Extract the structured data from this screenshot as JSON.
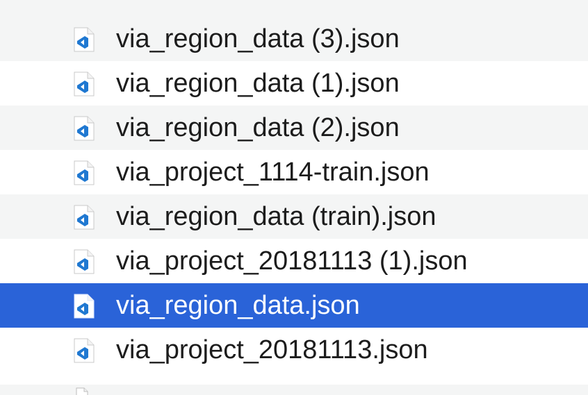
{
  "colors": {
    "stripe": "#f4f5f5",
    "selection": "#2a63d8",
    "text": "#1c1c1c",
    "selected_text": "#ffffff",
    "vscode_icon_blue": "#1f78d1"
  },
  "file_list": {
    "icon_name": "vscode-json-file-icon",
    "items": [
      {
        "name": "via_region_data (3).json",
        "selected": false
      },
      {
        "name": "via_region_data (1).json",
        "selected": false
      },
      {
        "name": "via_region_data (2).json",
        "selected": false
      },
      {
        "name": "via_project_1114-train.json",
        "selected": false
      },
      {
        "name": "via_region_data (train).json",
        "selected": false
      },
      {
        "name": "via_project_20181113 (1).json",
        "selected": false
      },
      {
        "name": "via_region_data.json",
        "selected": true
      },
      {
        "name": "via_project_20181113.json",
        "selected": false
      }
    ]
  }
}
